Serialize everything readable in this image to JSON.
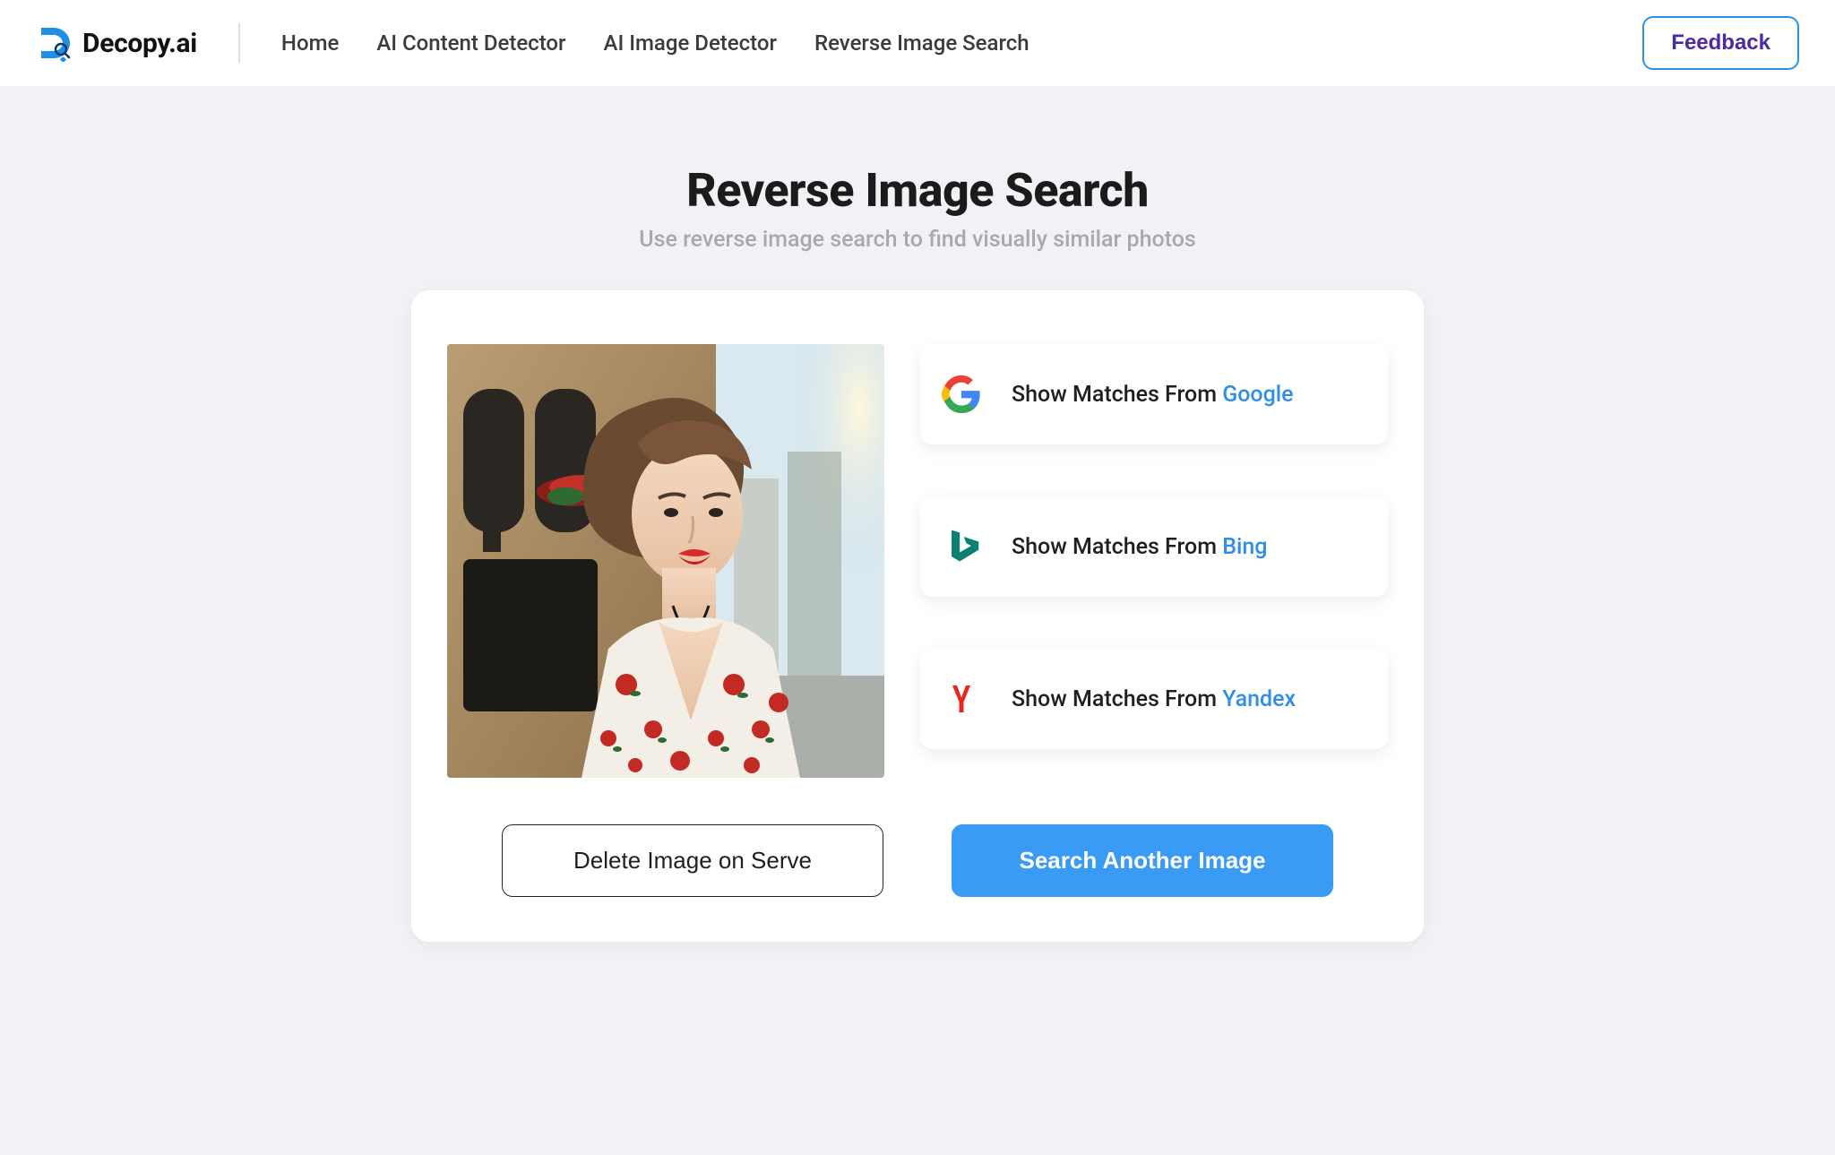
{
  "brand": {
    "name": "Decopy.ai"
  },
  "nav": {
    "home": "Home",
    "ai_content_detector": "AI Content Detector",
    "ai_image_detector": "AI Image Detector",
    "reverse_image_search": "Reverse Image Search"
  },
  "header": {
    "feedback": "Feedback"
  },
  "page": {
    "title": "Reverse Image Search",
    "subtitle": "Use reverse image search to find visually similar photos"
  },
  "matches": {
    "prefix": "Show Matches From ",
    "google": "Google",
    "bing": "Bing",
    "yandex": "Yandex"
  },
  "actions": {
    "delete": "Delete Image on Serve",
    "search_another": "Search Another Image"
  }
}
